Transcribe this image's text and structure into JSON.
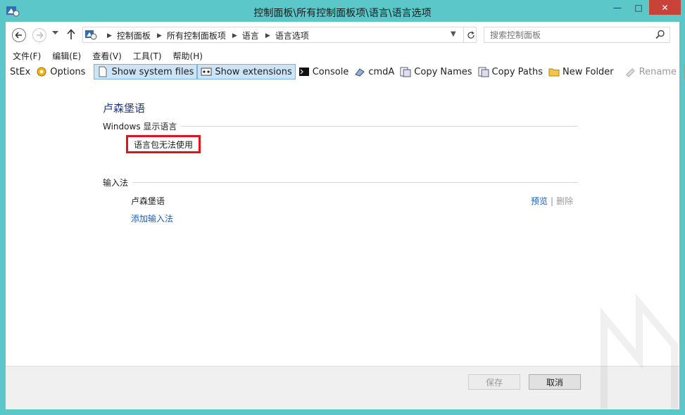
{
  "window": {
    "title": "控制面板\\所有控制面板项\\语言\\语言选项",
    "min_glyph": "—",
    "max_glyph": "□",
    "close_glyph": "✕"
  },
  "address": {
    "crumbs": [
      "控制面板",
      "所有控制面板项",
      "语言",
      "语言选项"
    ],
    "search_placeholder": "搜索控制面板"
  },
  "menu": [
    "文件(F)",
    "编辑(E)",
    "查看(V)",
    "工具(T)",
    "帮助(H)"
  ],
  "toolbar": {
    "stex": "StEx",
    "options": "Options",
    "show_system_files": "Show system files",
    "show_extensions": "Show extensions",
    "console": "Console",
    "cmda": "cmdA",
    "copy_names": "Copy Names",
    "copy_paths": "Copy Paths",
    "new_folder": "New Folder",
    "rename": "Rename"
  },
  "content": {
    "language_name": "卢森堡语",
    "display_language_heading": "Windows 显示语言",
    "language_pack_status": "语言包无法使用",
    "ime_heading": "输入法",
    "ime_name": "卢森堡语",
    "preview_link": "预览",
    "action_separator": "|",
    "delete_link": "删除",
    "add_ime_link": "添加输入法"
  },
  "buttons": {
    "save": "保存",
    "cancel": "取消"
  },
  "colors": {
    "frame": "#5bc7c9",
    "close": "#c7433a",
    "link": "#1c5fb5",
    "highlight_box": "#e0141c",
    "toggle_bg": "#cce4f7"
  }
}
